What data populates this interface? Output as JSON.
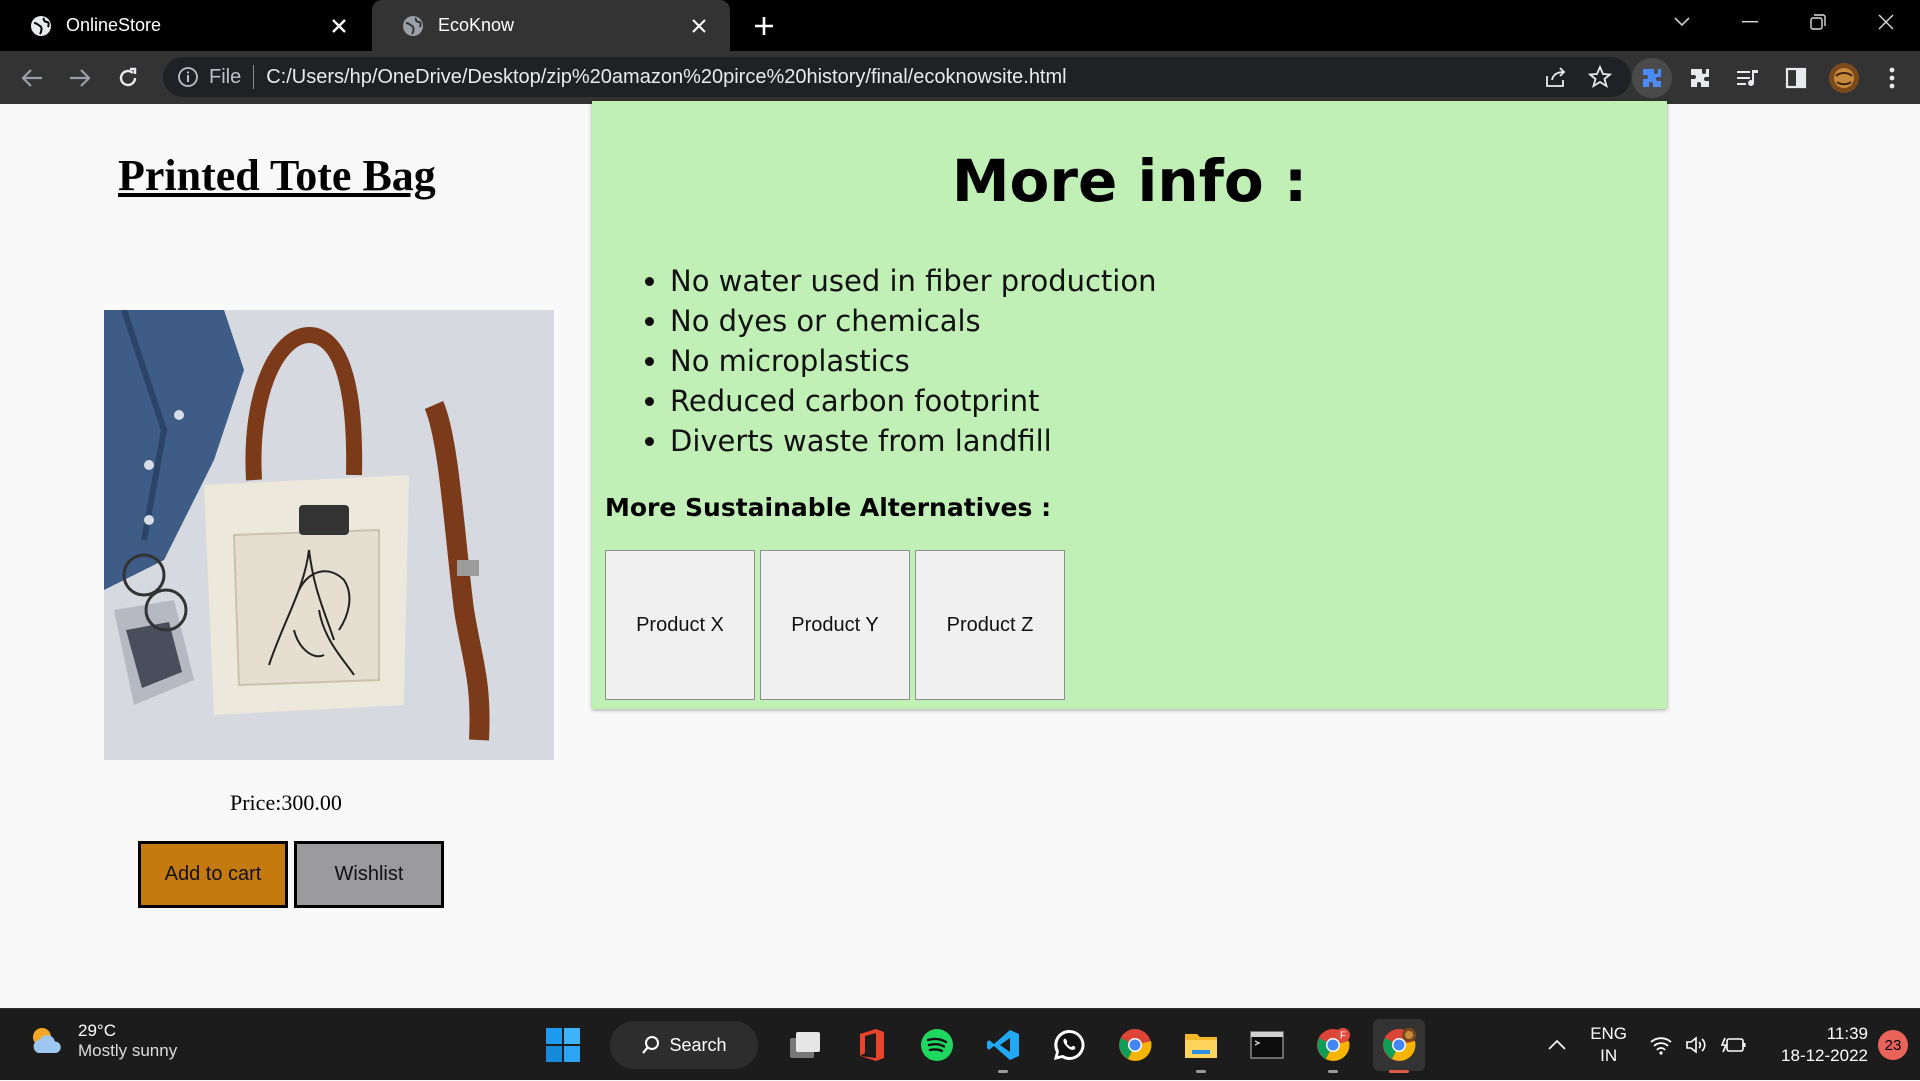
{
  "browser": {
    "tabs": [
      {
        "title": "OnlineStore",
        "active": false
      },
      {
        "title": "EcoKnow",
        "active": true
      }
    ],
    "address": {
      "scheme_label": "File",
      "url": "C:/Users/hp/OneDrive/Desktop/zip%20amazon%20pirce%20history/final/ecoknowsite.html"
    }
  },
  "product": {
    "title": "Printed Tote Bag",
    "price": "Price:300.00",
    "add_to_cart_label": "Add to cart",
    "wishlist_label": "Wishlist"
  },
  "info_panel": {
    "heading": "More info :",
    "benefits": [
      "No water used in fiber production",
      "No dyes or chemicals",
      "No microplastics",
      "Reduced carbon footprint",
      "Diverts waste from landfill"
    ],
    "alternatives_heading": "More Sustainable Alternatives :",
    "alternatives": [
      "Product X",
      "Product Y",
      "Product Z"
    ]
  },
  "taskbar": {
    "weather_temp": "29°C",
    "weather_condition": "Mostly sunny",
    "search_label": "Search",
    "language_line1": "ENG",
    "language_line2": "IN",
    "time": "11:39",
    "date": "18-12-2022",
    "notification_count": "23",
    "chrome_badge": "F"
  },
  "colors": {
    "panel_bg": "#c1f0b6",
    "add_to_cart_bg": "#c47a0f",
    "wishlist_bg": "#9b9a9c",
    "page_bg": "#f9f9f9"
  }
}
